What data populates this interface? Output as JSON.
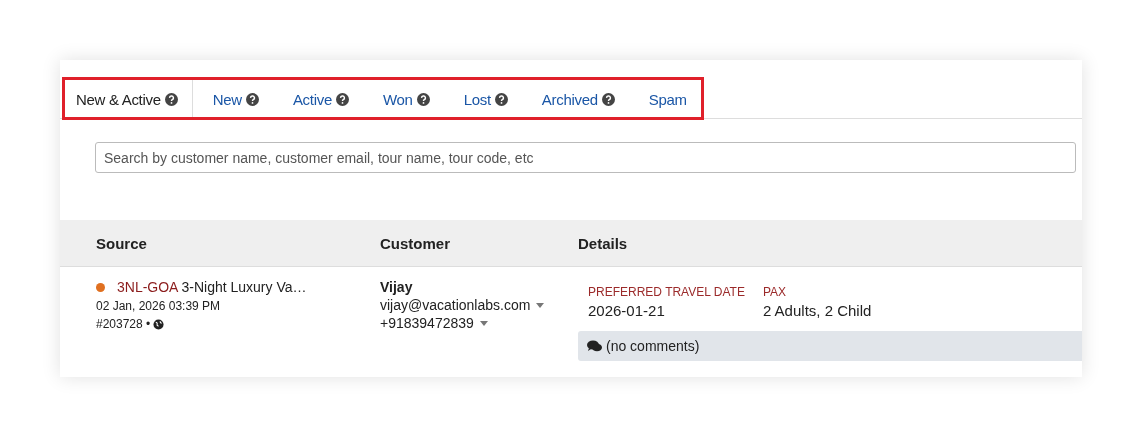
{
  "tabs": [
    {
      "label": "New & Active",
      "selected": true,
      "help": true
    },
    {
      "label": "New",
      "selected": false,
      "help": true
    },
    {
      "label": "Active",
      "selected": false,
      "help": true
    },
    {
      "label": "Won",
      "selected": false,
      "help": true
    },
    {
      "label": "Lost",
      "selected": false,
      "help": true
    },
    {
      "label": "Archived",
      "selected": false,
      "help": true
    },
    {
      "label": "Spam",
      "selected": false,
      "help": false
    }
  ],
  "search": {
    "placeholder": "Search by customer name, customer email, tour name, tour code, etc"
  },
  "table": {
    "columns": [
      "Source",
      "Customer",
      "Details"
    ],
    "rows": [
      {
        "color": "#e07020",
        "tour_code": "3NL-GOA",
        "tour_name": "3-Night Luxury Va…",
        "date": "02 Jan, 2026 03:39 PM",
        "id": "#203728 •",
        "customer_name": "Vijay",
        "email": "vijay@vacationlabs.com",
        "phone": "+91839472839",
        "details": [
          {
            "label": "PREFERRED TRAVEL DATE",
            "value": "2026-01-21"
          },
          {
            "label": "PAX",
            "value": "2 Adults, 2 Child"
          }
        ],
        "comments": "(no comments)"
      }
    ]
  }
}
